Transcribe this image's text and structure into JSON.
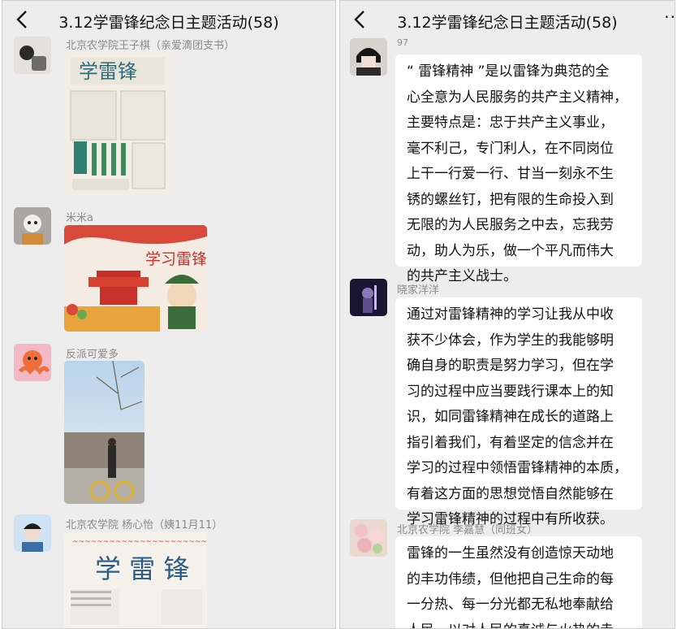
{
  "left": {
    "title": "3.12学雷锋纪念日主题活动(58)",
    "messages": [
      {
        "sender": "北京农学院王子棋（亲爱滴团支书）"
      },
      {
        "sender": "米米a"
      },
      {
        "sender": "反派可爱多"
      },
      {
        "sender": "北京农学院 杨心怡（姨11月11）"
      }
    ],
    "poster1_text": "学习雷锋",
    "poster3_text": "学 雷 锋"
  },
  "right": {
    "title": "3.12学雷锋纪念日主题活动(58)",
    "more": "··",
    "partial_sender": "97",
    "messages": [
      {
        "sender": "",
        "lines": [
          "“ 雷锋精神 ”是以雷锋为典范的全",
          "心全意为人民服务的共产主义精神，",
          "主要特点是：忠于共产主义事业，",
          "毫不利己，专门利人，在不同岗位",
          "上干一行爱一行、甘当一刻永不生",
          "锈的螺丝钉，把有限的生命投入到",
          "无限的为人民服务之中去，忘我劳",
          "动，助人为乐，做一个平凡而伟大",
          "的共产主义战士。"
        ]
      },
      {
        "sender": "晓家洋洋",
        "lines": [
          "通过对雷锋精神的学习让我从中收",
          "获不少体会，作为学生的我能够明",
          "确自身的职责是努力学习，但在学",
          "习的过程中应当要践行课本上的知",
          "识，如同雷锋精神在成长的道路上",
          "指引着我们，有着坚定的信念并在",
          "学习的过程中领悟雷锋精神的本质，",
          "有着这方面的思想觉悟自然能够在",
          "学习雷锋精神的过程中有所收获。"
        ]
      },
      {
        "sender": "北京农学院 李嘉慧（同班女）",
        "lines": [
          "雷锋的一生虽然没有创造惊天动地",
          "的丰功伟绩，但他把自己生命的每",
          "一分热、每一分光都无私地奉献给",
          "人民，以对人民的真诚与火热的赤"
        ]
      }
    ]
  },
  "colors": {
    "chat_bg": "#ededed",
    "bubble": "#ffffff",
    "name": "#8a8a8a"
  }
}
